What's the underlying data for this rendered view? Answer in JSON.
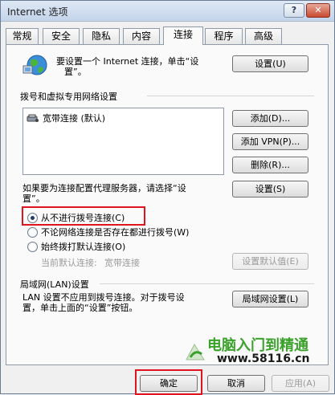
{
  "window": {
    "title": "Internet 选项",
    "help_glyph": "?",
    "close_glyph": "✕"
  },
  "tabs": [
    {
      "label": "常规",
      "active": false
    },
    {
      "label": "安全",
      "active": false
    },
    {
      "label": "隐私",
      "active": false
    },
    {
      "label": "内容",
      "active": false
    },
    {
      "label": "连接",
      "active": true
    },
    {
      "label": "程序",
      "active": false
    },
    {
      "label": "高级",
      "active": false
    }
  ],
  "setup": {
    "text_line1": "要设置一个 Internet 连接，单击“设",
    "text_line2": "置”。",
    "button": "设置(U)"
  },
  "dialup": {
    "group_title": "拨号和虚拟专用网络设置",
    "connections": [
      "宽带连接 (默认)"
    ],
    "add_button": "添加(D)...",
    "add_vpn_button": "添加 VPN(P)...",
    "delete_button": "删除(R)...",
    "proxy_text_line1": "如果要为连接配置代理服务器，请选择“设",
    "proxy_text_line2": "置”。",
    "settings_button": "设置(S)",
    "options": [
      {
        "label": "从不进行拨号连接(C)",
        "checked": true
      },
      {
        "label": "不论网络连接是否存在都进行拨号(W)",
        "checked": false
      },
      {
        "label": "始终拨打默认连接(O)",
        "checked": false
      }
    ],
    "current_default_label": "当前默认连接:",
    "current_default_value": "宽带连接",
    "set_default_button": "设置默认值(E)"
  },
  "lan": {
    "group_title": "局域网(LAN)设置",
    "text_line1": "LAN 设置不应用到拨号连接。对于拨号设",
    "text_line2": "置，单击上面的“设置”按钮。",
    "button": "局域网设置(L)"
  },
  "footer": {
    "ok_button": "确定",
    "cancel_button": "取消",
    "apply_button": "应用(A)"
  },
  "watermark": {
    "title": "电脑入门到精通",
    "url": "www.58116.cn"
  },
  "colors": {
    "highlight": "#e0141e",
    "watermark_green": "#3aa12a"
  }
}
